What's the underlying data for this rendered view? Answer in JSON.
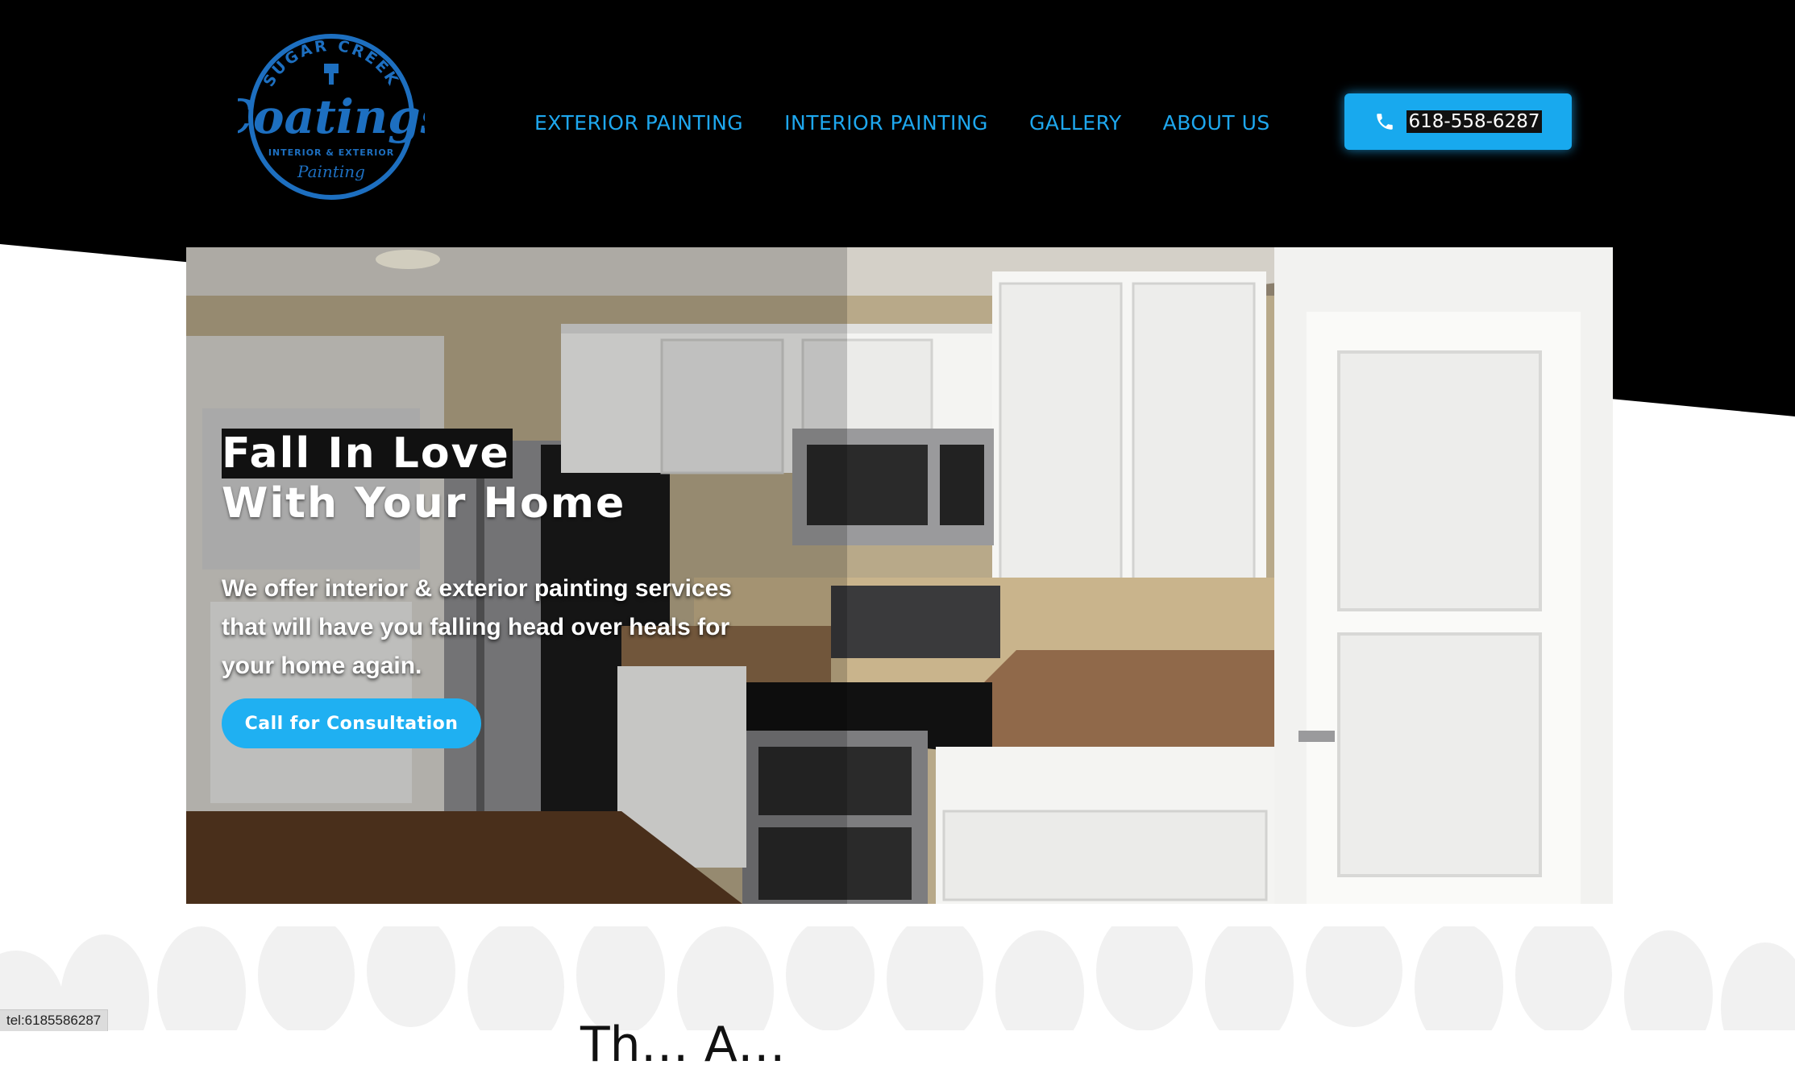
{
  "brand": {
    "arc_text": "SUGAR CREEK",
    "name": "Coatings",
    "tagline": "INTERIOR & EXTERIOR",
    "script": "Painting",
    "color": "#1d6fc0"
  },
  "nav": {
    "items": [
      {
        "label": "EXTERIOR PAINTING"
      },
      {
        "label": "INTERIOR PAINTING"
      },
      {
        "label": "GALLERY"
      },
      {
        "label": "ABOUT US"
      }
    ],
    "color": "#1ea7ee"
  },
  "phone": {
    "icon": "phone-icon",
    "number": "618-558-6287"
  },
  "hero": {
    "title_line1": "Fall In Love",
    "title_line2": "With Your Home",
    "subtitle": "We offer interior & exterior painting services that will have you falling head over heals for your home again.",
    "cta_label": "Call for Consultation"
  },
  "next_section": {
    "heading": "Th… A…"
  },
  "status_bar": {
    "url": "tel:6185586287"
  },
  "colors": {
    "accent": "#1fb0f2",
    "header_bg": "#000000"
  }
}
